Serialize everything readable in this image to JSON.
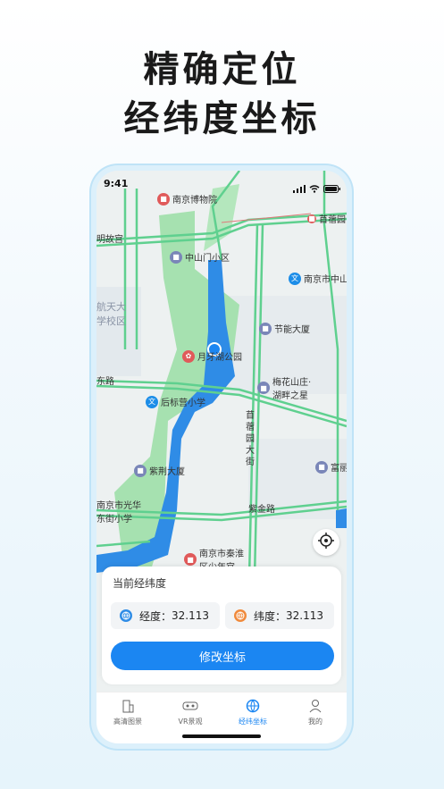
{
  "promo": {
    "line1": "精确定位",
    "line2": "经纬度坐标"
  },
  "status": {
    "time": "9:41"
  },
  "map": {
    "pois": {
      "museum": "南京博物院",
      "zhongshanmen": "中山门小区",
      "nanjing_zhongshan": "南京市中山",
      "aerospace1": "航天大",
      "aerospace2": "学校区",
      "jieneng": "节能大厦",
      "yueyahu": "月牙湖公园",
      "meihua1": "梅花山庄·",
      "meihua2": "湖畔之星",
      "houbiaoying": "后标营小学",
      "zijing": "紫荆大厦",
      "fuli": "富丽",
      "guanghua1": "南京市光华",
      "guanghua2": "东街小学",
      "qinhuai1": "南京市秦淮",
      "qinhuai2": "区少年宫",
      "xuxuyuan": "苜蓿园",
      "gugong": "明故宫"
    },
    "roads": {
      "xuxuyuan_street": "苜蓿园大街",
      "zijin_road": "紫金路",
      "road_left": "东路"
    }
  },
  "card": {
    "title": "当前经纬度",
    "longitude_label": "经度：",
    "longitude_value": "32.113",
    "latitude_label": "纬度：",
    "latitude_value": "32.113",
    "button": "修改坐标"
  },
  "tabs": [
    {
      "label": "高清图景"
    },
    {
      "label": "VR景观"
    },
    {
      "label": "经纬坐标"
    },
    {
      "label": "我的"
    }
  ],
  "colors": {
    "accent": "#1b86f2",
    "road": "#5fd08f",
    "water": "#2f8ce6",
    "park": "#9ddfa8"
  }
}
